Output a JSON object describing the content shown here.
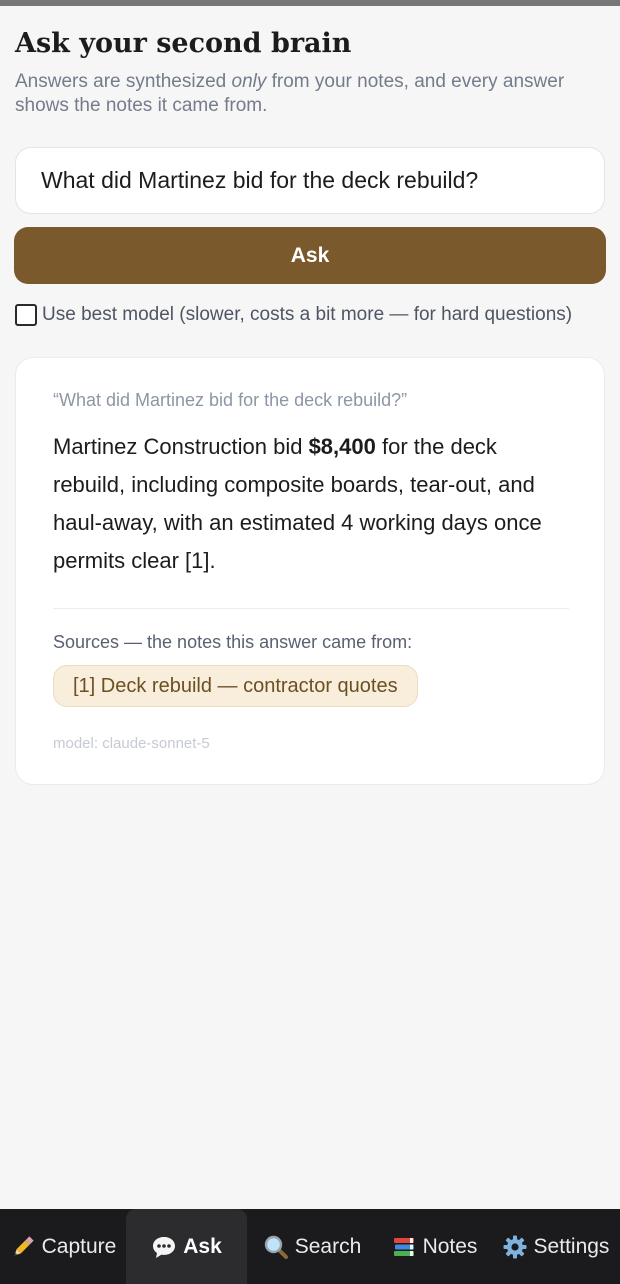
{
  "header": {
    "title": "Ask your second brain",
    "subtitle_pre": "Answers are synthesized ",
    "subtitle_em": "only",
    "subtitle_post": " from your notes, and every answer shows the notes it came from."
  },
  "question_input": {
    "value": "What did Martinez bid for the deck rebuild?"
  },
  "ask_button": {
    "label": "Ask"
  },
  "best_model": {
    "checked": false,
    "label": "Use best model (slower, costs a bit more — for hard questions)"
  },
  "answer": {
    "question_echo": "“What did Martinez bid for the deck rebuild?”",
    "text_pre": "Martinez Construction bid ",
    "text_bold": "$8,400",
    "text_post": " for the deck rebuild, including composite boards, tear-out, and haul-away, with an estimated 4 working days once permits clear [1].",
    "sources_heading": "Sources — the notes this answer came from:",
    "sources": [
      {
        "label": "[1] Deck rebuild — contractor quotes"
      }
    ],
    "model_line": "model: claude-sonnet-5"
  },
  "nav": {
    "active": "Ask",
    "tabs": [
      {
        "label": "Capture",
        "icon": "pencil-icon"
      },
      {
        "label": "Ask",
        "icon": "speech-bubble-icon"
      },
      {
        "label": "Search",
        "icon": "magnifier-icon"
      },
      {
        "label": "Notes",
        "icon": "books-icon"
      },
      {
        "label": "Settings",
        "icon": "gear-icon"
      }
    ]
  },
  "colors": {
    "brand_brown": "#7a5a2c",
    "source_chip_bg": "#f8eedb",
    "nav_bg": "#1b1b1d"
  }
}
